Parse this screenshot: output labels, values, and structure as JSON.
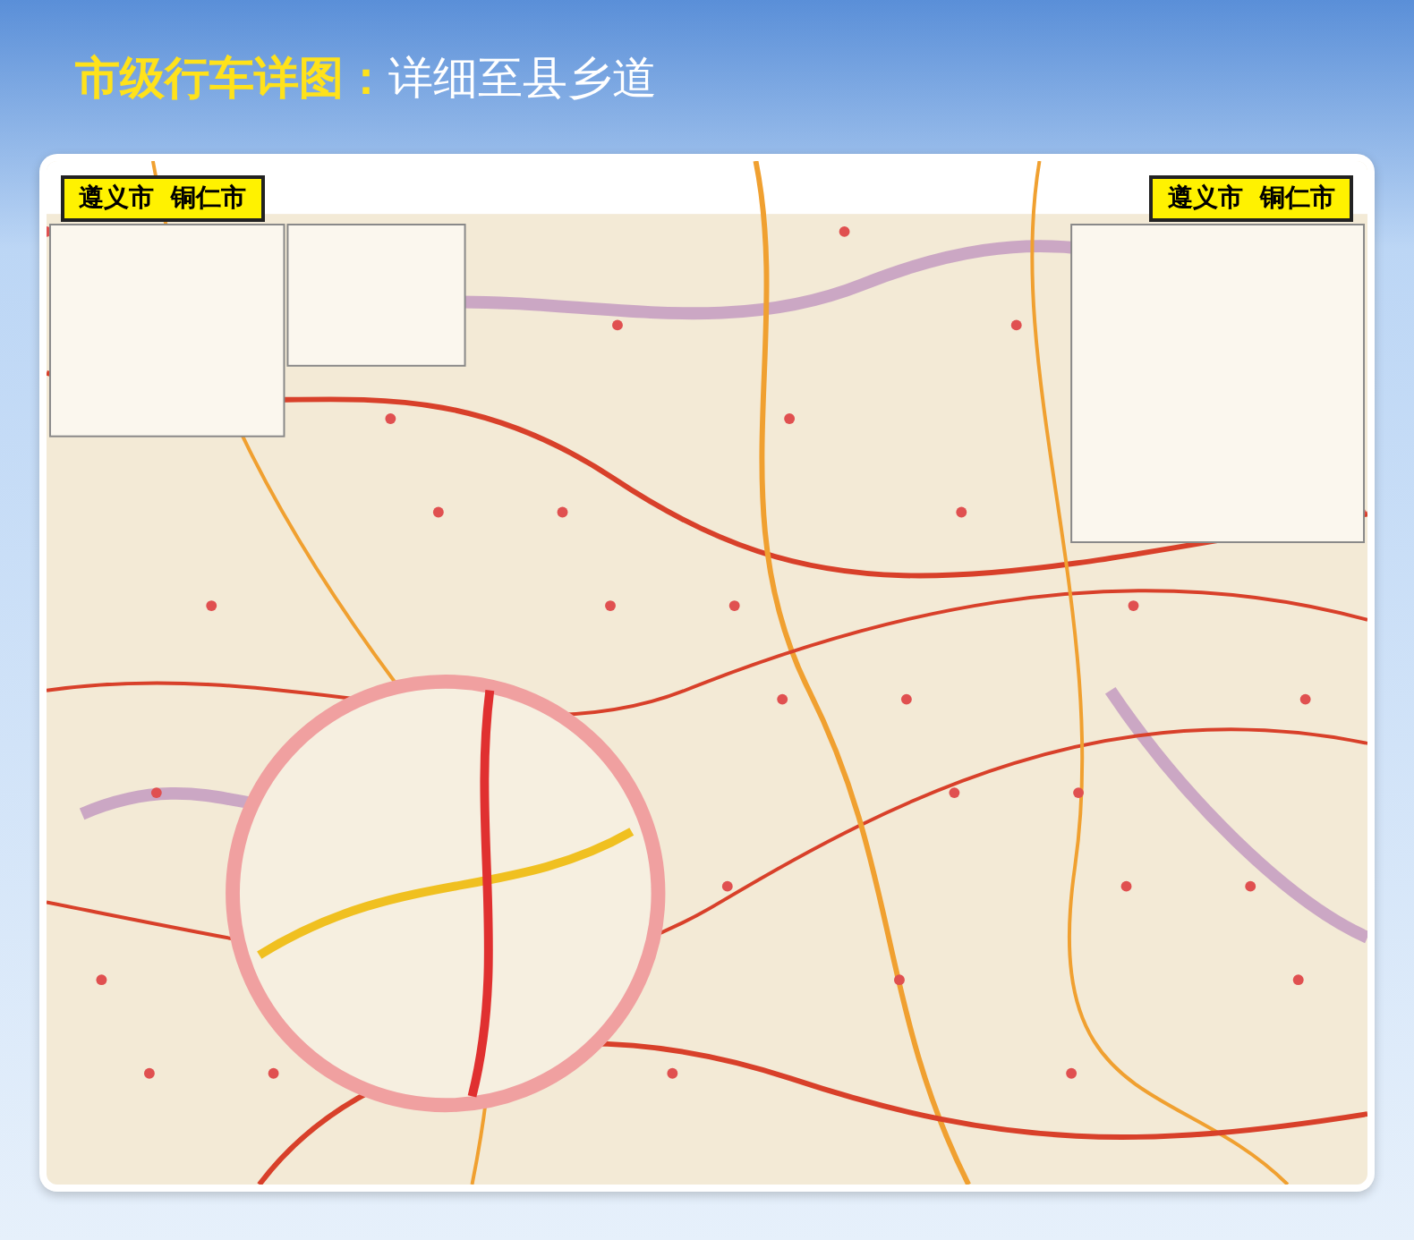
{
  "header": {
    "title_highlight": "市级行车详图：",
    "title_rest": "详细至县乡道"
  },
  "map": {
    "labels": [
      {
        "text": "遵义市  铜仁市"
      },
      {
        "text": "遵义市  铜仁市"
      }
    ]
  }
}
